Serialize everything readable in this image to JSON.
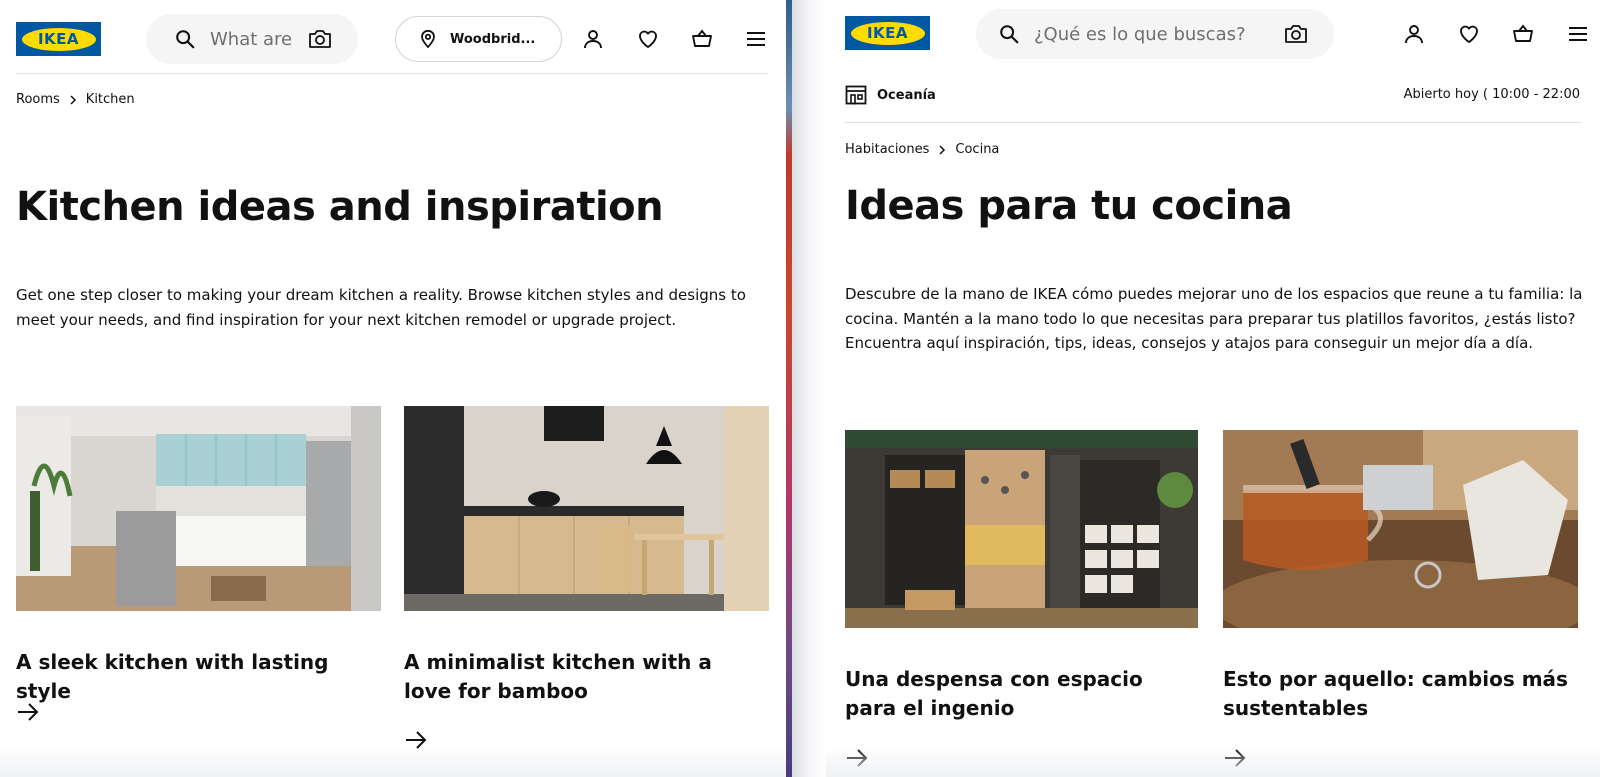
{
  "colors": {
    "ikea_blue": "#0058a3",
    "ikea_yellow": "#ffdb00",
    "text": "#111111",
    "search_bg": "#f5f5f5"
  },
  "left": {
    "logo_text": "IKEA",
    "search": {
      "placeholder": "What are",
      "icon": "search-icon",
      "camera_icon": "camera-icon"
    },
    "store": {
      "label": "Woodbrid...",
      "icon": "location-pin-icon"
    },
    "header_icons": [
      "account-icon",
      "heart-icon",
      "basket-icon",
      "menu-icon"
    ],
    "breadcrumb": [
      "Rooms",
      "Kitchen"
    ],
    "title": "Kitchen ideas and inspiration",
    "intro": "Get one step closer to making your dream kitchen a reality. Browse kitchen styles and designs to meet your needs, and find inspiration for your next kitchen remodel or upgrade project.",
    "cards": [
      {
        "title": "A sleek kitchen with lasting style"
      },
      {
        "title": "A minimalist kitchen with a love for bamboo"
      }
    ]
  },
  "right": {
    "logo_text": "IKEA",
    "search": {
      "placeholder": "¿Qué es lo que buscas?",
      "icon": "search-icon",
      "camera_icon": "camera-icon"
    },
    "header_icons": [
      "account-icon",
      "heart-icon",
      "basket-icon",
      "menu-icon"
    ],
    "store_name": "Oceanía",
    "hours": "Abierto hoy ( 10:00 - 22:00",
    "breadcrumb": [
      "Habitaciones",
      "Cocina"
    ],
    "title": "Ideas para tu cocina",
    "intro": "Descubre de la mano de IKEA cómo puedes mejorar uno de los espacios que reune a tu familia: la cocina. Mantén a la mano todo lo que necesitas para preparar tus platillos favoritos, ¿estás listo? Encuentra aquí inspiración, tips, ideas, consejos y atajos para conseguir un mejor día a día.",
    "cards": [
      {
        "title": "Una despensa con espacio para el ingenio"
      },
      {
        "title": "Esto por aquello: cambios más sustentables"
      }
    ]
  }
}
